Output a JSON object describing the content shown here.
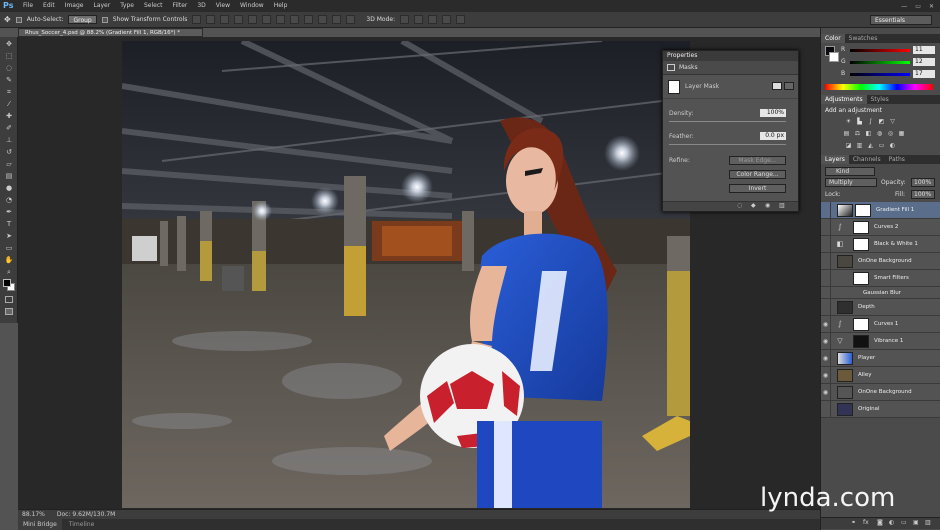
{
  "menubar": {
    "logo": "Ps",
    "items": [
      "File",
      "Edit",
      "Image",
      "Layer",
      "Type",
      "Select",
      "Filter",
      "3D",
      "View",
      "Window",
      "Help"
    ],
    "window_controls": [
      "—",
      "▭",
      "✕"
    ]
  },
  "options": {
    "auto_select_label": "Auto-Select:",
    "auto_select_value": "Group",
    "show_transform_label": "Show Transform Controls",
    "mode_3d_label": "3D Mode:",
    "workspace": "Essentials"
  },
  "document": {
    "tab_title": "Rhus_Soccer_4.psd @ 88.2% (Gradient Fill 1, RGB/16*) *",
    "zoom": "88.17%",
    "doc_size": "Doc: 9.62M/130.7M"
  },
  "bottom_tabs": [
    "Mini Bridge",
    "Timeline"
  ],
  "properties": {
    "title": "Properties",
    "section": "Masks",
    "mask_type": "Layer Mask",
    "density_label": "Density:",
    "density_value": "100%",
    "feather_label": "Feather:",
    "feather_value": "0.0 px",
    "refine_label": "Refine:",
    "mask_edge": "Mask Edge...",
    "color_range": "Color Range...",
    "invert": "Invert"
  },
  "color_panel": {
    "tabs": [
      "Color",
      "Swatches"
    ],
    "r": "11",
    "g": "12",
    "b": "17",
    "labels": [
      "R",
      "G",
      "B"
    ]
  },
  "adjustments": {
    "tabs": [
      "Adjustments",
      "Styles"
    ],
    "title": "Add an adjustment"
  },
  "layers": {
    "tabs": [
      "Layers",
      "Channels",
      "Paths"
    ],
    "kind": "Kind",
    "blend": "Multiply",
    "opacity_label": "Opacity:",
    "opacity": "100%",
    "lock_label": "Lock:",
    "fill_label": "Fill:",
    "fill": "100%",
    "items": [
      {
        "name": "Gradient Fill 1",
        "selected": true
      },
      {
        "name": "Curves 2"
      },
      {
        "name": "Black & White 1"
      },
      {
        "name": "OnOne Background"
      },
      {
        "name": "Smart Filters"
      },
      {
        "name": "Gaussian Blur"
      },
      {
        "name": "Depth"
      },
      {
        "name": "Curves 1"
      },
      {
        "name": "Vibrance 1"
      },
      {
        "name": "Player"
      },
      {
        "name": "Alley"
      },
      {
        "name": "OnOne Background"
      },
      {
        "name": "Original"
      }
    ]
  },
  "watermark": "lynda.com"
}
